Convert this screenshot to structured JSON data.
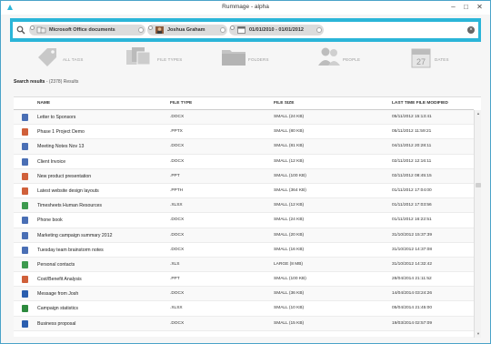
{
  "window": {
    "title": "Rummage - alpha",
    "minimize_label": "–",
    "maximize_label": "□",
    "close_label": "✕"
  },
  "search": {
    "chips": [
      {
        "label": "Microsoft Office documents",
        "icon": "office-docs-icon"
      },
      {
        "label": "Joshua Graham",
        "icon": "person-photo-icon"
      },
      {
        "label": "01/01/2010 - 01/01/2012",
        "icon": "calendar-icon"
      }
    ],
    "clear_label": "×"
  },
  "facets": [
    {
      "label": "ALL TAGS",
      "icon": "tag-icon"
    },
    {
      "label": "FILE TYPES",
      "icon": "file-types-icon"
    },
    {
      "label": "FOLDERS",
      "icon": "folder-icon"
    },
    {
      "label": "PEOPLE",
      "icon": "people-icon"
    },
    {
      "label": "DATES",
      "icon": "calendar-icon",
      "day": "27"
    }
  ],
  "results": {
    "title": "Search results",
    "count_text": "- (2378) Results"
  },
  "table": {
    "columns": [
      "NAME",
      "FILE TYPE",
      "FILE SIZE",
      "LAST TIME FILE MODIFIED"
    ],
    "rows": [
      {
        "icon": "word-icon",
        "color": "#4a6fb5",
        "name": "Letter to Sponsors",
        "type": ".DOCX",
        "size": "SMALL (24 KB)",
        "modified": "05/11/2012 15:13:41"
      },
      {
        "icon": "powerpoint-icon",
        "color": "#d0603a",
        "name": "Phase 1 Project Demo",
        "type": ".PPTX",
        "size": "SMALL (80 KB)",
        "modified": "05/11/2012 11:59:21"
      },
      {
        "icon": "word-icon",
        "color": "#4a6fb5",
        "name": "Meeting Notes Nov 13",
        "type": ".DOCX",
        "size": "SMALL (81 KB)",
        "modified": "04/11/2012 20:28:11"
      },
      {
        "icon": "word-icon",
        "color": "#4a6fb5",
        "name": "Client Invoice",
        "type": ".DOCX",
        "size": "SMALL (12 KB)",
        "modified": "02/11/2012 12:16:11"
      },
      {
        "icon": "powerpoint-icon",
        "color": "#d0603a",
        "name": "New product presentation",
        "type": ".PPT",
        "size": "SMALL (100 KB)",
        "modified": "02/11/2012 08:45:15"
      },
      {
        "icon": "powerpoint-icon",
        "color": "#d0603a",
        "name": "Latest website design layouts",
        "type": ".PPTH",
        "size": "SMALL (364 KB)",
        "modified": "01/11/2012 17:04:00"
      },
      {
        "icon": "excel-icon",
        "color": "#3d9a4e",
        "name": "Timesheets Human Resources",
        "type": ".XLSX",
        "size": "SMALL (12 KB)",
        "modified": "01/11/2012 17:03:56"
      },
      {
        "icon": "word-icon",
        "color": "#4a6fb5",
        "name": "Phone book",
        "type": ".DOCX",
        "size": "SMALL (24 KB)",
        "modified": "01/11/2012 16:22:51"
      },
      {
        "icon": "word-icon",
        "color": "#4a6fb5",
        "name": "Marketing campaign summary 2012",
        "type": ".DOCX",
        "size": "SMALL (20 KB)",
        "modified": "31/10/2012 15:37:39"
      },
      {
        "icon": "word-icon",
        "color": "#4a6fb5",
        "name": "Tuesday team brainstorm notes",
        "type": ".DOCX",
        "size": "SMALL (16 KB)",
        "modified": "31/10/2012 14:37:08"
      },
      {
        "icon": "excel-icon",
        "color": "#3d9a4e",
        "name": "Personal contacts",
        "type": ".XLS",
        "size": "LARGE (8 MB)",
        "modified": "31/10/2012 14:32:42"
      },
      {
        "icon": "powerpoint-icon",
        "color": "#d0603a",
        "name": "Cost/Benefit Analysis",
        "type": ".PPT",
        "size": "SMALL (100 KB)",
        "modified": "28/04/2014 21:11:52"
      },
      {
        "icon": "word-icon",
        "color": "#2b5fb0",
        "name": "Message from Josh",
        "type": ".DOCX",
        "size": "SMALL (36 KB)",
        "modified": "14/04/2014 03:24:26"
      },
      {
        "icon": "excel-icon",
        "color": "#2d8a3e",
        "name": "Campaign statistics",
        "type": ".XLSX",
        "size": "SMALL (10 KB)",
        "modified": "05/04/2014 21:45:00"
      },
      {
        "icon": "word-icon",
        "color": "#2b5fb0",
        "name": "Business proposal",
        "type": ".DOCX",
        "size": "SMALL (15 KB)",
        "modified": "19/03/2014 02:57:09"
      }
    ]
  },
  "scrollbar": {
    "up_label": "▲",
    "down_label": "▼"
  },
  "colors": {
    "accent": "#2bb5d8",
    "border": "#4aa3c9"
  }
}
